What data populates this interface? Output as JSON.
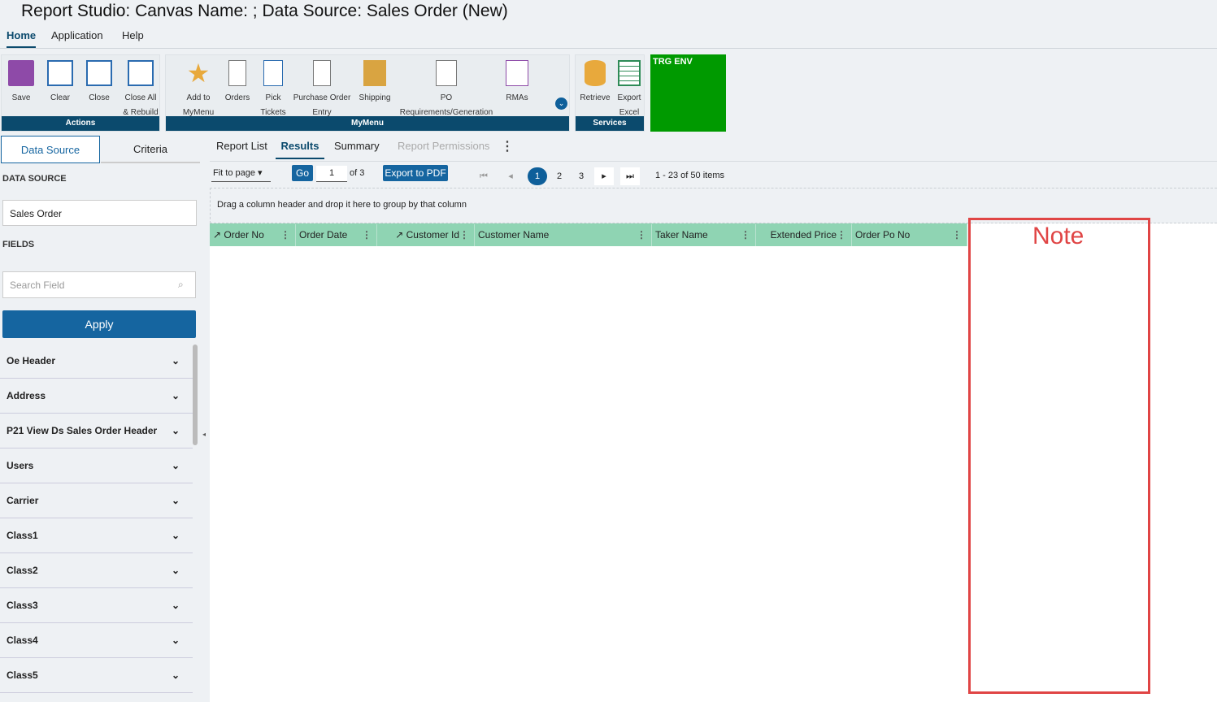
{
  "window_title": "Report Studio: Canvas Name: ; Data Source: Sales Order (New)",
  "menu": [
    "Home",
    "Application",
    "Help"
  ],
  "ribbon": {
    "actions": {
      "label": "Actions",
      "items": [
        {
          "l1": "Save",
          "l2": ""
        },
        {
          "l1": "Clear",
          "l2": ""
        },
        {
          "l1": "Close",
          "l2": ""
        },
        {
          "l1": "Close All",
          "l2": "& Rebuild"
        }
      ]
    },
    "mymenu": {
      "label": "MyMenu",
      "items": [
        {
          "l1": "Add to",
          "l2": "MyMenu"
        },
        {
          "l1": "Orders",
          "l2": ""
        },
        {
          "l1": "Pick",
          "l2": "Tickets"
        },
        {
          "l1": "Purchase Order",
          "l2": "Entry"
        },
        {
          "l1": "Shipping",
          "l2": ""
        },
        {
          "l1": "PO",
          "l2": "Requirements/Generation"
        },
        {
          "l1": "RMAs",
          "l2": ""
        }
      ]
    },
    "services": {
      "label": "Services",
      "items": [
        {
          "l1": "Retrieve",
          "l2": ""
        },
        {
          "l1": "Export",
          "l2": "Excel"
        }
      ]
    },
    "env": "TRG ENV"
  },
  "left": {
    "tabs": [
      "Data Source",
      "Criteria"
    ],
    "data_source_label": "DATA SOURCE",
    "data_source_value": "Sales Order",
    "fields_label": "FIELDS",
    "search_placeholder": "Search Field",
    "apply": "Apply",
    "groups": [
      "Oe Header",
      "Address",
      "P21 View Ds Sales Order Header",
      "Users",
      "Carrier",
      "Class1",
      "Class2",
      "Class3",
      "Class4",
      "Class5"
    ]
  },
  "main": {
    "tabs": [
      "Report List",
      "Results",
      "Summary",
      "Report Permissions"
    ],
    "fit": "Fit to page",
    "go": "Go",
    "page": "1",
    "of": "of 3",
    "export_pdf": "Export to PDF",
    "pages": [
      "1",
      "2",
      "3"
    ],
    "items_info": "1 - 23 of 50 items",
    "group_hint": "Drag a column header and drop it here to group by that column",
    "columns": [
      "Order No",
      "Order Date",
      "Customer Id",
      "Customer Name",
      "Taker Name",
      "Extended Price",
      "Order Po No"
    ]
  },
  "note": "Note"
}
